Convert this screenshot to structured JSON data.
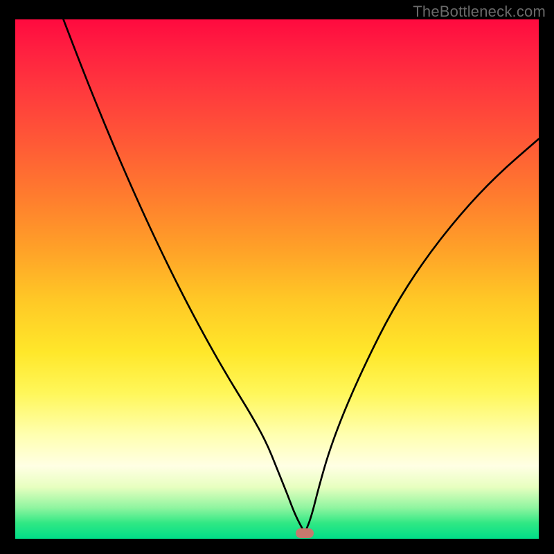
{
  "watermark": "TheBottleneck.com",
  "chart_data": {
    "type": "line",
    "title": "",
    "xlabel": "",
    "ylabel": "",
    "xlim": [
      0,
      100
    ],
    "ylim": [
      0,
      100
    ],
    "grid": false,
    "legend": false,
    "marker": {
      "x": 55.3,
      "y": 1.1
    },
    "series": [
      {
        "name": "left-branch",
        "x": [
          9.2,
          13,
          17,
          21,
          25,
          29,
          33,
          37,
          41,
          45,
          48,
          50,
          52,
          53.5,
          55.3
        ],
        "y": [
          100,
          90,
          80,
          70.5,
          61.5,
          53,
          45,
          37.5,
          30.5,
          24,
          18.5,
          13.5,
          8.5,
          4.5,
          1.1
        ]
      },
      {
        "name": "right-branch",
        "x": [
          55.3,
          56.5,
          58,
          60,
          63,
          67,
          72,
          78,
          85,
          92,
          100
        ],
        "y": [
          1.1,
          4,
          10,
          17,
          25,
          34,
          44,
          53.5,
          62.5,
          70,
          77
        ]
      }
    ]
  }
}
